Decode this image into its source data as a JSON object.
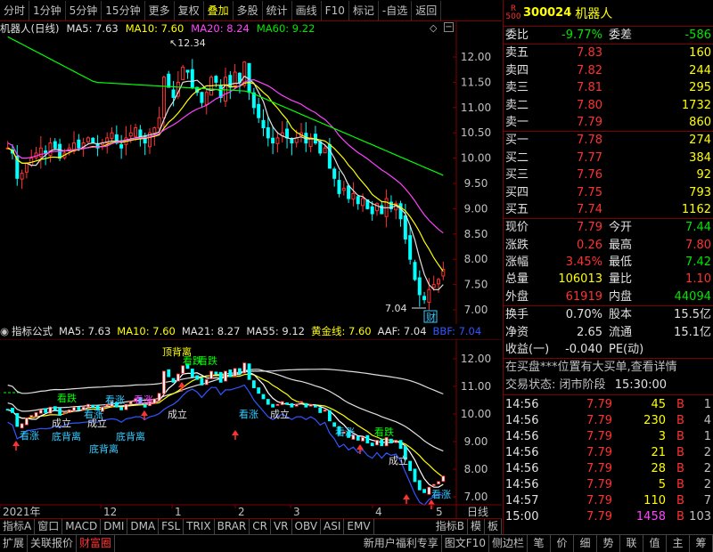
{
  "toolbar": {
    "items": [
      "分时",
      "1分钟",
      "5分钟",
      "15分钟",
      "更多",
      "复权",
      "叠加",
      "多股",
      "统计",
      "画线",
      "F10",
      "标记",
      "-自选",
      "返回"
    ]
  },
  "kline": {
    "title": "机器人(日线)",
    "ma5": "MA5: 7.63",
    "ma10": "MA10: 7.60",
    "ma20": "MA20: 8.24",
    "ma60": "MA60: 9.22",
    "high_label": "12.34",
    "low_label": "7.04",
    "low_tag": "财",
    "axis_labels": [
      "12.00",
      "11.50",
      "11.00",
      "10.50",
      "10.00",
      "9.50",
      "9.00",
      "8.50",
      "8.00",
      "7.50",
      "7.00"
    ],
    "colors": {
      "ma5": "#e0e0e0",
      "ma10": "#ffff00",
      "ma20": "#ff44ff",
      "ma60": "#00ff00",
      "up": "#ff3232",
      "down": "#00ffff"
    }
  },
  "indicator": {
    "name": "指标公式",
    "ma5": "MA5: 7.63",
    "ma10": "MA10: 7.60",
    "ma21": "MA21: 8.27",
    "ma55": "MA55: 9.12",
    "gold": "黄金线: 7.60",
    "aaf": "AAF: 7.04",
    "bbf": "BBF: 7.04",
    "axis_labels": [
      "12.00",
      "11.00",
      "10.00",
      "9.00",
      "8.00",
      "7.00"
    ],
    "tags": [
      "顶背离",
      "看跌",
      "看跌",
      "看涨",
      "成立",
      "看涨",
      "成立",
      "底背离",
      "底背离",
      "底背离",
      "看涨",
      "成立",
      "看跌",
      "看涨",
      "看涨",
      "成立",
      "看跌",
      "看涨",
      "成立",
      "看涨"
    ]
  },
  "time_axis": [
    "2021年",
    "12",
    "1",
    "2",
    "3",
    "4",
    "5"
  ],
  "time_axis_right": "日线",
  "bottom_tabs": [
    "指标A",
    "窗口",
    "MACD",
    "DMI",
    "DMA",
    "FSL",
    "TRIX",
    "BRAR",
    "CR",
    "VR",
    "OBV",
    "ASI",
    "EMV",
    "指标B",
    "模",
    "板"
  ],
  "status_bar": {
    "left": [
      "扩展",
      "关联报价",
      "财富圈"
    ],
    "right": [
      "新用户福利专享",
      "图文F10",
      "侧边栏"
    ],
    "icons": [
      "笔",
      "价",
      "细",
      "势",
      "联",
      "值",
      "主",
      "筹"
    ]
  },
  "quote": {
    "r_label": "R\n500",
    "code": "300024",
    "name": "机器人",
    "webi_label": "委比",
    "webi": "-9.77%",
    "weicha_label": "委差",
    "weicha": "-586",
    "sells": [
      {
        "label": "卖五",
        "price": "7.83",
        "vol": "160"
      },
      {
        "label": "卖四",
        "price": "7.82",
        "vol": "244"
      },
      {
        "label": "卖三",
        "price": "7.81",
        "vol": "295"
      },
      {
        "label": "卖二",
        "price": "7.80",
        "vol": "1732"
      },
      {
        "label": "卖一",
        "price": "7.79",
        "vol": "860"
      }
    ],
    "buys": [
      {
        "label": "买一",
        "price": "7.78",
        "vol": "274"
      },
      {
        "label": "买二",
        "price": "7.77",
        "vol": "384"
      },
      {
        "label": "买三",
        "price": "7.76",
        "vol": "92"
      },
      {
        "label": "买四",
        "price": "7.75",
        "vol": "793"
      },
      {
        "label": "买五",
        "price": "7.74",
        "vol": "1162"
      }
    ],
    "stats": [
      {
        "l1": "现价",
        "v1": "7.79",
        "c1": "red",
        "l2": "今开",
        "v2": "7.44",
        "c2": "green"
      },
      {
        "l1": "涨跌",
        "v1": "0.26",
        "c1": "red",
        "l2": "最高",
        "v2": "7.80",
        "c2": "red"
      },
      {
        "l1": "涨幅",
        "v1": "3.45%",
        "c1": "red",
        "l2": "最低",
        "v2": "7.42",
        "c2": "green"
      },
      {
        "l1": "总量",
        "v1": "106013",
        "c1": "yellow",
        "l2": "量比",
        "v2": "1.10",
        "c2": "red"
      },
      {
        "l1": "外盘",
        "v1": "61919",
        "c1": "red",
        "l2": "内盘",
        "v2": "44094",
        "c2": "green"
      }
    ],
    "stats2": [
      {
        "l1": "换手",
        "v1": "0.70%",
        "l2": "股本",
        "v2": "15.5亿"
      },
      {
        "l1": "净资",
        "v1": "2.65",
        "l2": "流通",
        "v2": "15.1亿"
      },
      {
        "l1": "收益(一)",
        "v1": "-0.040",
        "l2": "PE(动)",
        "v2": ""
      }
    ],
    "news": "在买盘***位置有大买单,查看详情",
    "trade_status_label": "交易状态:",
    "trade_status": "闭市阶段",
    "trade_time": "15:30:00",
    "ticks": [
      {
        "t": "14:56",
        "p": "7.79",
        "q": "45",
        "d": "B",
        "c": "1"
      },
      {
        "t": "14:56",
        "p": "7.79",
        "q": "230",
        "d": "B",
        "c": "4"
      },
      {
        "t": "14:56",
        "p": "7.79",
        "q": "3",
        "d": "B",
        "c": "1"
      },
      {
        "t": "14:56",
        "p": "7.79",
        "q": "21",
        "d": "B",
        "c": "2"
      },
      {
        "t": "14:56",
        "p": "7.79",
        "q": "28",
        "d": "B",
        "c": "2"
      },
      {
        "t": "14:56",
        "p": "7.79",
        "q": "5",
        "d": "B",
        "c": "2"
      },
      {
        "t": "14:57",
        "p": "7.79",
        "q": "110",
        "d": "B",
        "c": "7"
      },
      {
        "t": "15:00",
        "p": "7.79",
        "q": "1458",
        "d": "B",
        "c": "103"
      }
    ]
  }
}
